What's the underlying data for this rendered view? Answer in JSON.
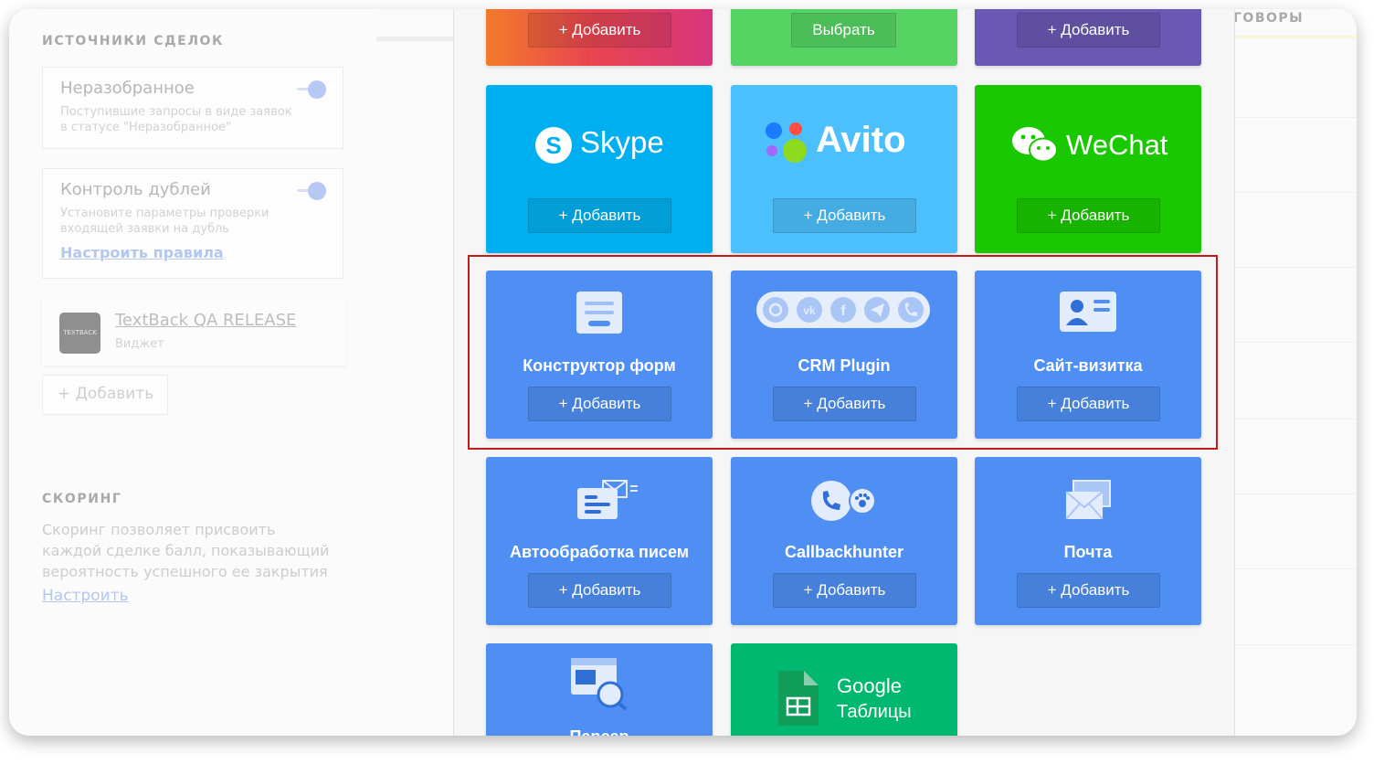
{
  "left": {
    "sources_title": "ИСТОЧНИКИ СДЕЛОК",
    "unsorted": {
      "title": "Неразобранное",
      "desc": "Поступившие запросы в виде заявок в статусе \"Неразобранное\""
    },
    "duplicates": {
      "title": "Контроль дублей",
      "desc": "Установите параметры проверки входящей заявки на дубль",
      "link": "Настроить правила"
    },
    "widget": {
      "logo": "TEXTBACK",
      "name": "TextBack QA RELEASE",
      "sub": "Виджет"
    },
    "add": "+ Добавить",
    "scoring_title": "СКОРИНГ",
    "scoring_desc": "Скоринг позволяет присвоить каждой сделке балл, показывающий вероятность успешного ее закрытия",
    "scoring_link": "Настроить"
  },
  "right": {
    "header": "ГОВОРЫ"
  },
  "tiles": {
    "top1": {
      "btn": "+ Добавить"
    },
    "top2": {
      "btn": "Выбрать"
    },
    "top3": {
      "btn": "+ Добавить"
    },
    "skype": {
      "brand": "Skype",
      "btn": "+ Добавить"
    },
    "avito": {
      "brand": "Avito",
      "btn": "+ Добавить"
    },
    "wechat": {
      "brand": "WeChat",
      "btn": "+ Добавить"
    },
    "forms": {
      "label": "Конструктор форм",
      "btn": "+ Добавить"
    },
    "crm": {
      "label": "CRM Plugin",
      "btn": "+ Добавить"
    },
    "site": {
      "label": "Сайт-визитка",
      "btn": "+ Добавить"
    },
    "autoletters": {
      "label": "Автообработка писем",
      "btn": "+ Добавить"
    },
    "callback": {
      "label": "Callbackhunter",
      "btn": "+ Добавить"
    },
    "mail": {
      "label": "Почта",
      "btn": "+ Добавить"
    },
    "parser": {
      "label": "Парсер"
    },
    "gsheets": {
      "brand1": "Google",
      "brand2": "Таблицы"
    }
  },
  "colors": {
    "blue": "#4f8ff4",
    "skype": "#00aff0",
    "avito": "#4cbffd",
    "wechat": "#1ac800",
    "sheets": "#00b86f",
    "highlight": "#c21b1b"
  }
}
